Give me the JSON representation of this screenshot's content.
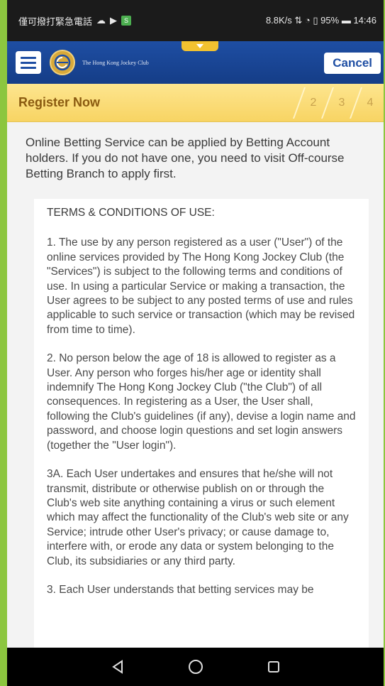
{
  "status_bar": {
    "carrier_text": "僅可撥打緊急電話",
    "network_speed": "8.8K/s",
    "battery": "95%",
    "time": "14:46"
  },
  "app_bar": {
    "logo_text": "The Hong Kong Jockey Club",
    "cancel_label": "Cancel"
  },
  "register": {
    "title": "Register Now",
    "steps": [
      "2",
      "3",
      "4"
    ]
  },
  "intro_text": "Online Betting Service can be applied by Betting Account holders. If you do not have one, you need to visit Off-course Betting Branch to apply first.",
  "terms": {
    "heading": "TERMS & CONDITIONS OF USE:",
    "paragraphs": [
      "1. The use by any person registered as a user (\"User\") of the online services provided by The Hong Kong Jockey Club (the \"Services\") is subject to the following terms and conditions of use. In using a particular Service or making a transaction, the User agrees to be subject to any posted terms of use and rules applicable to such service or transaction (which may be revised from time to time).",
      "2. No person below the age of 18 is allowed to register as a User. Any person who forges his/her age or identity shall indemnify The Hong Kong Jockey Club (\"the Club\") of all consequences. In registering as a User, the User shall, following the Club's guidelines (if any), devise a login name and password, and choose login questions and set login answers (together the \"User login\").",
      "3A. Each User undertakes and ensures that he/she will not transmit, distribute or otherwise publish on or through the Club's web site anything containing a virus or such element which may affect the functionality of the Club's web site or any Service; intrude other User's privacy; or cause damage to, interfere with, or erode any data or system belonging to the Club, its subsidiaries or any third party.",
      "3. Each User understands that betting services may be"
    ]
  },
  "nav": {
    "back_icon": "back-triangle-icon",
    "home_icon": "home-circle-icon",
    "recents_icon": "recents-square-icon"
  },
  "colors": {
    "brand_blue": "#1e4ea3",
    "register_yellow": "#f8d463",
    "frame_green": "#8cc63f"
  }
}
